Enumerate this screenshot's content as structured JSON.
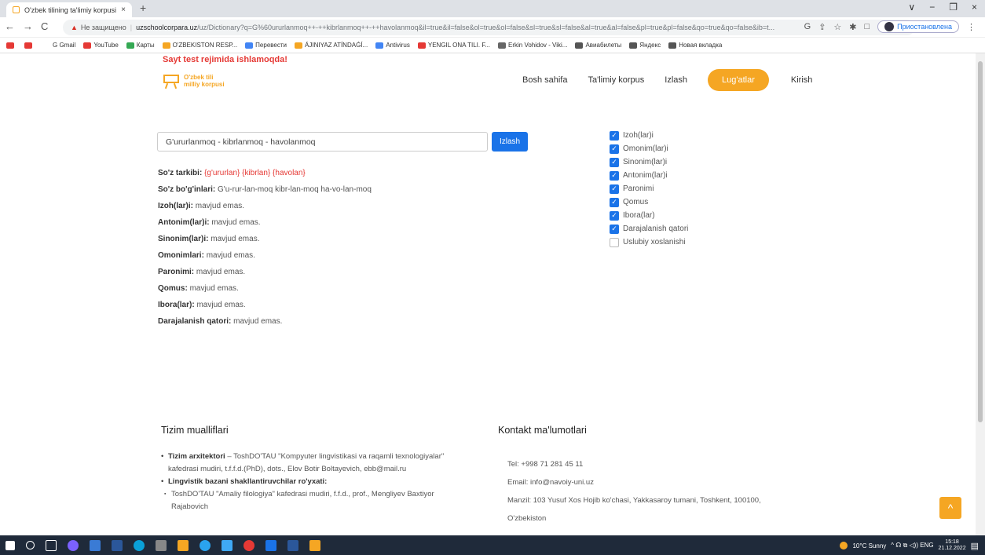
{
  "browser": {
    "tab_title": "O'zbek tilining ta'limiy korpusi",
    "tab_close": "×",
    "new_tab": "+",
    "window_controls": [
      "∨",
      "−",
      "❐",
      "×"
    ],
    "nav": [
      "←",
      "→",
      "C"
    ],
    "url_warning": "▲",
    "url_insecure": "Не защищено",
    "url_host": "uzschoolcorpara.uz",
    "url_rest": "/uz/Dictionary?q=G%60ururlanmoq++-++kibrlanmoq++-++havolanmoq&il=true&il=false&ol=true&ol=false&sl=true&sl=false&al=true&al=false&pl=true&pl=false&qo=true&qo=false&ib=t...",
    "addr_icons": [
      "G",
      "⇪",
      "☆",
      "✱",
      "□"
    ],
    "profile_label": "Приостановлена",
    "menu_dots": "⋮",
    "bookmarks": [
      {
        "label": "",
        "color": "#e53935"
      },
      {
        "label": "",
        "color": "#e53935"
      },
      {
        "label": "G Gmail",
        "color": "#ffffff"
      },
      {
        "label": "YouTube",
        "color": "#e53935"
      },
      {
        "label": "Карты",
        "color": "#34a853"
      },
      {
        "label": "O'ZBEKISTON RESP...",
        "color": "#f5a623"
      },
      {
        "label": "Перевести",
        "color": "#4285f4"
      },
      {
        "label": "ÁJINIYAZ ATÍNDAǴÍ...",
        "color": "#f5a623"
      },
      {
        "label": "Antivirus",
        "color": "#4285f4"
      },
      {
        "label": "YENGIL ONA TILI. F...",
        "color": "#e53935"
      },
      {
        "label": "Erkin Vohidov - Viki...",
        "color": "#666666"
      },
      {
        "label": "Авиабилеты",
        "color": "#555555"
      },
      {
        "label": "Яндекс",
        "color": "#555555"
      },
      {
        "label": "Новая вкладка",
        "color": "#555555"
      }
    ]
  },
  "site": {
    "notice": "Sayt test rejimida ishlamoqda!",
    "logo_line1": "O'zbek tili",
    "logo_line2": "milliy korpusi",
    "menu": {
      "home": "Bosh sahifa",
      "corpus": "Ta'limiy korpus",
      "search": "Izlash",
      "dictionaries": "Lug'atlar",
      "login": "Kirish"
    },
    "search_value": "G'ururlanmoq  -  kibrlanmoq  -  havolanmoq",
    "search_button": "Izlash",
    "results": {
      "composition_label": "So'z tarkibi:",
      "composition_parts": [
        "{g'ururlan}",
        "{kibrlan}",
        "{havolan}"
      ],
      "syllables_label": "So'z bo'g'inlari:",
      "syllables_value": "G'u-rur-lan-moq kibr-lan-moq ha-vo-lan-moq",
      "rows": [
        {
          "label": "Izoh(lar)i:",
          "value": "mavjud emas."
        },
        {
          "label": "Antonim(lar)i:",
          "value": "mavjud emas."
        },
        {
          "label": "Sinonim(lar)i:",
          "value": "mavjud emas."
        },
        {
          "label": "Omonimlari:",
          "value": "mavjud emas."
        },
        {
          "label": "Paronimi:",
          "value": "mavjud emas."
        },
        {
          "label": "Qomus:",
          "value": "mavjud emas."
        },
        {
          "label": "Ibora(lar):",
          "value": "mavjud emas."
        },
        {
          "label": "Darajalanish qatori:",
          "value": "mavjud emas."
        }
      ]
    },
    "filters": [
      {
        "label": "Izoh(lar)i",
        "checked": true
      },
      {
        "label": "Omonim(lar)i",
        "checked": true
      },
      {
        "label": "Sinonim(lar)i",
        "checked": true
      },
      {
        "label": "Antonim(lar)i",
        "checked": true
      },
      {
        "label": "Paronimi",
        "checked": true
      },
      {
        "label": "Qomus",
        "checked": true
      },
      {
        "label": "Ibora(lar)",
        "checked": true
      },
      {
        "label": "Darajalanish qatori",
        "checked": true
      },
      {
        "label": "Uslubiy xoslanishi",
        "checked": false
      }
    ],
    "footer": {
      "authors_title": "Tizim mualliflari",
      "architect_label": "Tizim arxitektori",
      "architect_text": " – ToshDO'TAU \"Kompyuter lingvistikasi va raqamli texnologiyalar\" kafedrasi mudiri, t.f.f.d.(PhD), dots., Elov Botir Boltayevich, ebb@mail.ru",
      "builders_label": "Lingvistik bazani shakllantiruvchilar ro'yxati:",
      "builder_1": "ToshDO'TAU \"Amaliy filologiya\" kafedrasi mudiri, f.f.d., prof., Mengliyev Baxtiyor Rajabovich",
      "contact_title": "Kontakt ma'lumotlari",
      "tel": "Tel: +998 71 281 45 11",
      "email": "Email: info@navoiy-uni.uz",
      "address": "Manzil: 103 Yusuf Xos Hojib ko'chasi, Yakkasaroy tumani, Toshkent, 100100,",
      "country": "O'zbekiston",
      "to_top": "^"
    }
  },
  "taskbar": {
    "weather": "10°C  Sunny",
    "tray": "^ ☊ ⧉ ◁)) ENG",
    "time": "15:18",
    "date": "21.12.2022"
  }
}
